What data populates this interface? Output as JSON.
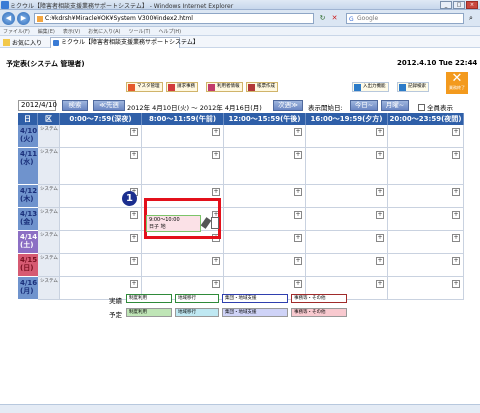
{
  "window": {
    "title": "ミクウル【障害者相談支援業務サポートシステム】 - Windows Internet Explorer"
  },
  "addressbar": {
    "url": "C:¥kdrsh¥Miracle¥OK¥System V300¥index2.html",
    "search_placeholder": "Google"
  },
  "menu": [
    "ファイル(F)",
    "編集(E)",
    "表示(V)",
    "お気に入り(A)",
    "ツール(T)",
    "ヘルプ(H)"
  ],
  "favorites": {
    "label": "お気に入り",
    "tab": "ミクウル【障害者相談支援業務サポートシステム】"
  },
  "page": {
    "title": "予定表(システム 管理者)",
    "datetime": "2012.4.10 Tue 22:44"
  },
  "toolbar": [
    {
      "label": "マスタ管理",
      "color": "#e55a2b"
    },
    {
      "label": "請求事務",
      "color": "#d23b3b"
    },
    {
      "label": "利用者情報",
      "color": "#c23b6a"
    },
    {
      "label": "帳票作成",
      "color": "#b23838"
    }
  ],
  "toolbar_right": [
    {
      "label": "入出力機能",
      "color": "#2c7bc8"
    },
    {
      "label": "記録検索",
      "color": "#2c7bc8"
    }
  ],
  "exit": {
    "label": "業務終了"
  },
  "nav": {
    "date_value": "2012/4/10",
    "search": "検索",
    "prev_week": "≪先週",
    "range": "2012年 4月10日(火) 〜 2012年 4月16日(月)",
    "next_week": "次週≫",
    "start_label": "表示開始日:",
    "today": "今日~",
    "monday": "月曜~",
    "all_label": "全員表示"
  },
  "grid": {
    "headers": [
      "日",
      "区",
      "0:00〜7:59(深夜)",
      "8:00〜11:59(午前)",
      "12:00〜15:59(午後)",
      "16:00〜19:59(夕方)",
      "20:00〜23:59(夜間)"
    ],
    "days": [
      {
        "d": "4/10",
        "w": "(火)",
        "kind": "システム",
        "type": "weekday"
      },
      {
        "d": "4/11",
        "w": "(水)",
        "kind": "システム",
        "type": "weekday"
      },
      {
        "d": "4/12",
        "w": "(木)",
        "kind": "システム",
        "type": "weekday"
      },
      {
        "d": "4/13",
        "w": "(金)",
        "kind": "システム",
        "type": "weekday"
      },
      {
        "d": "4/14",
        "w": "(土)",
        "kind": "システム",
        "type": "sat"
      },
      {
        "d": "4/15",
        "w": "(日)",
        "kind": "システム",
        "type": "sun"
      },
      {
        "d": "4/16",
        "w": "(月)",
        "kind": "システム",
        "type": "weekday"
      }
    ],
    "plus": "+"
  },
  "event": {
    "time": "9:00〜10:00",
    "name": "日子 地"
  },
  "badge": "1",
  "legend": {
    "actual_label": "実績",
    "plan_label": "予定",
    "actual": [
      {
        "text": "制度利用",
        "color": "#2f8a3a"
      },
      {
        "text": "地域移行",
        "color": "#2f8a3a"
      },
      {
        "text": "集団・地域支援",
        "color": "#2f3fae"
      },
      {
        "text": "事務等・その他",
        "color": "#a02b2b"
      }
    ],
    "plan": [
      {
        "text": "制度利用",
        "color": "#bfe5b6"
      },
      {
        "text": "地域移行",
        "color": "#bfe8f2"
      },
      {
        "text": "集団・地域支援",
        "color": "#cfd3f7"
      },
      {
        "text": "事務等・その他",
        "color": "#f8c9cf"
      }
    ]
  }
}
